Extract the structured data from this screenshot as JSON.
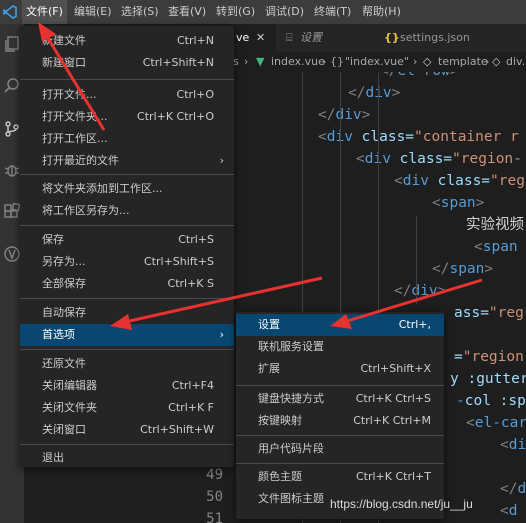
{
  "menubar": {
    "items": [
      "文件(F)",
      "编辑(E)",
      "选择(S)",
      "查看(V)",
      "转到(G)",
      "调试(D)",
      "终端(T)",
      "帮助(H)"
    ]
  },
  "tabs": [
    {
      "label": "ve",
      "icon": "vue-icon"
    },
    {
      "label": "设置",
      "icon": "settings-file-icon"
    },
    {
      "label": "settings.json",
      "icon": "json-icon"
    }
  ],
  "breadcrumb": {
    "folder": "s",
    "file": "index.vue",
    "section": "\"index.vue\"",
    "template": "template",
    "element": "div.hom"
  },
  "editor": {
    "lines": [
      {
        "parts": [
          "</",
          "el-row",
          ">"
        ],
        "kind": "close"
      },
      {
        "parts": [
          "</",
          "div",
          ">"
        ],
        "kind": "close"
      },
      {
        "parts": [
          "</",
          "div",
          ">"
        ],
        "kind": "close"
      },
      {
        "parts": [
          "<",
          "div ",
          "class=",
          "\"container r"
        ],
        "kind": "open"
      },
      {
        "parts": [
          "<",
          "div ",
          "class=",
          "\"region-"
        ],
        "kind": "open"
      },
      {
        "parts": [
          "<",
          "div ",
          "class=",
          "\"reg"
        ],
        "kind": "open"
      },
      {
        "parts": [
          "<",
          "span",
          ">"
        ],
        "kind": "close"
      },
      {
        "text": "实验视频"
      },
      {
        "parts": [
          "<",
          "span ",
          "c"
        ],
        "kind": "partial"
      },
      {
        "parts": [
          "</",
          "span",
          ">"
        ],
        "kind": "close"
      },
      {
        "parts": [
          "</",
          "div",
          ">"
        ],
        "kind": "close"
      },
      {
        "attr": "ass=",
        "str": "\"reg"
      },
      {
        "empty": true
      },
      {
        "attr": "=",
        "str": "\"region-"
      },
      {
        "attr": "y :gutter",
        "str": ""
      },
      {
        "parts": [
          "-",
          "col :sp"
        ],
        "kind": "frag"
      },
      {
        "parts": [
          "<",
          "el-car"
        ],
        "kind": "frag2"
      },
      {
        "parts": [
          "<",
          "di"
        ],
        "kind": "frag2"
      },
      {
        "empty": true
      },
      {
        "parts": [
          "</",
          "d"
        ],
        "kind": "frag2"
      },
      {
        "parts": [
          "<",
          "d"
        ],
        "kind": "frag2"
      }
    ],
    "line_numbers": [
      "49",
      "50",
      "51"
    ]
  },
  "file_menu": {
    "items": [
      {
        "label": "新建文件",
        "shortcut": "Ctrl+N"
      },
      {
        "label": "新建窗口",
        "shortcut": "Ctrl+Shift+N"
      },
      {
        "label": "打开文件...",
        "shortcut": "Ctrl+O"
      },
      {
        "label": "打开文件夹...",
        "shortcut": "Ctrl+K Ctrl+O"
      },
      {
        "label": "打开工作区...",
        "shortcut": ""
      },
      {
        "label": "打开最近的文件",
        "shortcut": "",
        "submenu": true
      },
      {
        "label": "将文件夹添加到工作区...",
        "shortcut": ""
      },
      {
        "label": "将工作区另存为...",
        "shortcut": ""
      },
      {
        "label": "保存",
        "shortcut": "Ctrl+S"
      },
      {
        "label": "另存为...",
        "shortcut": "Ctrl+Shift+S"
      },
      {
        "label": "全部保存",
        "shortcut": "Ctrl+K S"
      },
      {
        "label": "自动保存",
        "shortcut": ""
      },
      {
        "label": "首选项",
        "shortcut": "",
        "submenu": true,
        "highlighted": true
      },
      {
        "label": "还原文件",
        "shortcut": ""
      },
      {
        "label": "关闭编辑器",
        "shortcut": "Ctrl+F4"
      },
      {
        "label": "关闭文件夹",
        "shortcut": "Ctrl+K F"
      },
      {
        "label": "关闭窗口",
        "shortcut": "Ctrl+Shift+W"
      },
      {
        "label": "退出",
        "shortcut": ""
      }
    ]
  },
  "prefs_menu": {
    "items": [
      {
        "label": "设置",
        "shortcut": "Ctrl+,",
        "highlighted": true
      },
      {
        "label": "联机服务设置",
        "shortcut": ""
      },
      {
        "label": "扩展",
        "shortcut": "Ctrl+Shift+X"
      },
      {
        "label": "键盘快捷方式",
        "shortcut": "Ctrl+K Ctrl+S"
      },
      {
        "label": "按键映射",
        "shortcut": "Ctrl+K Ctrl+M"
      },
      {
        "label": "用户代码片段",
        "shortcut": ""
      },
      {
        "label": "颜色主题",
        "shortcut": "Ctrl+K Ctrl+T"
      },
      {
        "label": "文件图标主题",
        "shortcut": ""
      }
    ]
  },
  "watermark": "https://blog.csdn.net/ju__ju",
  "colors": {
    "menu_bg": "#252526",
    "highlight": "#094771",
    "arrow": "#e8322f",
    "keyword": "#569cd6",
    "attribute": "#9cdcfe",
    "string": "#ce9178"
  }
}
